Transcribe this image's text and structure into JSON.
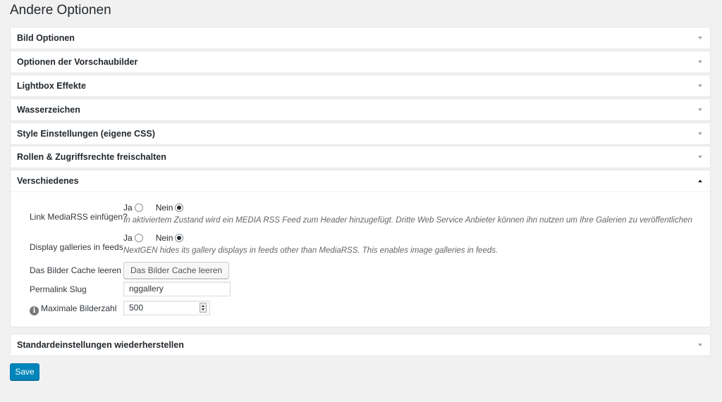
{
  "page": {
    "title": "Andere Optionen"
  },
  "sections": [
    {
      "title": "Bild Optionen",
      "expanded": false
    },
    {
      "title": "Optionen der Vorschaubilder",
      "expanded": false
    },
    {
      "title": "Lightbox Effekte",
      "expanded": false
    },
    {
      "title": "Wasserzeichen",
      "expanded": false
    },
    {
      "title": "Style Einstellungen (eigene CSS)",
      "expanded": false
    },
    {
      "title": "Rollen & Zugriffsrechte freischalten",
      "expanded": false
    },
    {
      "title": "Verschiedenes",
      "expanded": true
    },
    {
      "title": "Standardeinstellungen wiederherstellen",
      "expanded": false
    }
  ],
  "misc": {
    "mediarss": {
      "label": "Link MediaRSS einfügen?",
      "yes_label": "Ja",
      "no_label": "Nein",
      "selected": "Nein",
      "description": "In aktiviertem Zustand wird ein MEDIA RSS Feed zum Header hinzugefügt. Dritte Web Service Anbieter können ihn nutzen um Ihre Galerien zu veröffentlichen"
    },
    "feeds": {
      "label": "Display galleries in feeds",
      "yes_label": "Ja",
      "no_label": "Nein",
      "selected": "Nein",
      "description": "NextGEN hides its gallery displays in feeds other than MediaRSS. This enables image galleries in feeds."
    },
    "cache": {
      "label": "Das Bilder Cache leeren",
      "button_label": "Das Bilder Cache leeren"
    },
    "slug": {
      "label": "Permalink Slug",
      "value": "nggallery"
    },
    "max_images": {
      "label": "Maximale Bilderzahl",
      "value": "500",
      "icon": "info-icon"
    }
  },
  "actions": {
    "save_label": "Save"
  },
  "colors": {
    "primary": "#0085ba",
    "background": "#f1f1f1",
    "panel": "#ffffff"
  }
}
